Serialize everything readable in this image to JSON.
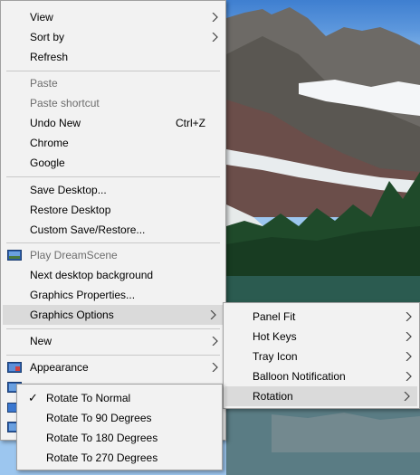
{
  "main_menu": {
    "items": [
      {
        "label": "View"
      },
      {
        "label": "Sort by"
      },
      {
        "label": "Refresh"
      },
      {
        "label": "Paste"
      },
      {
        "label": "Paste shortcut"
      },
      {
        "label": "Undo New",
        "shortcut": "Ctrl+Z"
      },
      {
        "label": "Chrome"
      },
      {
        "label": "Google"
      },
      {
        "label": "Save Desktop..."
      },
      {
        "label": "Restore Desktop"
      },
      {
        "label": "Custom Save/Restore..."
      },
      {
        "label": "Play DreamScene"
      },
      {
        "label": "Next desktop background"
      },
      {
        "label": "Graphics Properties..."
      },
      {
        "label": "Graphics Options"
      },
      {
        "label": "New"
      },
      {
        "label": "Appearance"
      }
    ]
  },
  "graphics_submenu": {
    "items": [
      {
        "label": "Panel Fit"
      },
      {
        "label": "Hot Keys"
      },
      {
        "label": "Tray Icon"
      },
      {
        "label": "Balloon Notification"
      },
      {
        "label": "Rotation"
      }
    ]
  },
  "rotation_submenu": {
    "items": [
      {
        "label": "Rotate To Normal",
        "checked": true
      },
      {
        "label": "Rotate To 90 Degrees"
      },
      {
        "label": "Rotate To 180 Degrees"
      },
      {
        "label": "Rotate To 270 Degrees"
      }
    ]
  },
  "colors": {
    "menu_bg": "#f2f2f2",
    "highlight_bg": "#dadada",
    "disabled_text": "#6d6d6d",
    "separator": "#c8c8c8"
  }
}
